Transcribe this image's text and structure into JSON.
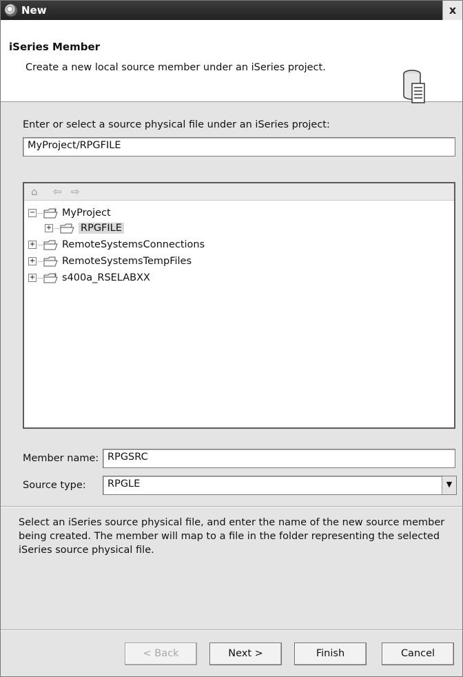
{
  "window": {
    "title": "New",
    "close_glyph": "x"
  },
  "header": {
    "title": "iSeries Member",
    "description": "Create a new local source member under an iSeries project.",
    "icon": "database-document-icon"
  },
  "source_file": {
    "prompt": "Enter or select a source physical file under an iSeries project:",
    "value": "MyProject/RPGFILE"
  },
  "tree": {
    "toolbar_icons": [
      "home-icon",
      "back-arrow-icon",
      "forward-arrow-icon"
    ],
    "items": [
      {
        "label": "MyProject",
        "expanded": true
      },
      {
        "label": "RPGFILE",
        "selected": true
      },
      {
        "label": "RemoteSystemsConnections"
      },
      {
        "label": "RemoteSystemsTempFiles"
      },
      {
        "label": "s400a_RSELABXX"
      }
    ]
  },
  "member": {
    "label": "Member name:",
    "value": "RPGSRC"
  },
  "source_type": {
    "label": "Source type:",
    "value": "RPGLE"
  },
  "info_text": "Select an iSeries source physical file, and enter the name of the new source member being created. The member will map to a file in the folder representing the selected iSeries source physical file.",
  "buttons": {
    "back": "< Back",
    "next": "Next >",
    "finish": "Finish",
    "cancel": "Cancel"
  }
}
